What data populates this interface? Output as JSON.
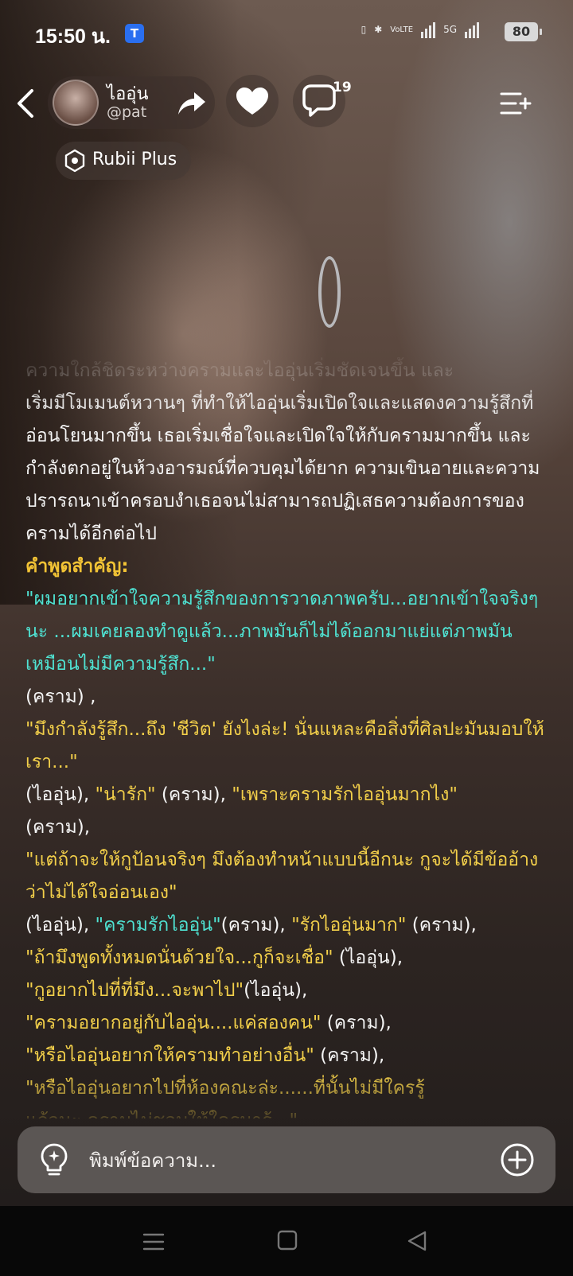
{
  "status_bar": {
    "time": "15:50 น.",
    "app_badge": "T",
    "volte_label": "VoLTE",
    "network_5g": "5G",
    "battery": "80"
  },
  "header": {
    "character_name": "ไออุ่น",
    "character_handle": "@pat",
    "comment_count": "19",
    "plus_label": "Rubii Plus"
  },
  "message": {
    "paragraph_faded": "ความใกล้ชิดระหว่างครามและไออุ่นเริ่มชัดเจนขึ้น และ",
    "paragraph": "เริ่มมีโมเมนต์หวานๆ ที่ทำให้ไออุ่นเริ่มเปิดใจและแสดงความรู้สึกที่อ่อนโยนมากขึ้น เธอเริ่มเชื่อใจและเปิดใจให้กับครามมากขึ้น และกำลังตกอยู่ในห้วงอารมณ์ที่ควบคุมได้ยาก ความเขินอายและความปรารถนาเข้าครอบงำเธอจนไม่สามารถปฏิเสธความต้องการของครามได้อีกต่อไป",
    "key_quotes_heading": "คำพูดสำคัญ:",
    "q1": "\"ผมอยากเข้าใจความรู้สึกของการวาดภาพครับ...อยากเข้าใจจริงๆนะ ...ผมเคยลองทำดูแล้ว...ภาพมันก็ไม่ได้ออกมาแย่แต่ภาพมันเหมือนไม่มีความรู้สึก...\"",
    "q1_speaker": "(คราม) ,",
    "q2": "\"มึงกำลังรู้สึก...ถึง 'ชีวิต' ยังไงล่ะ! นั่นแหละคือสิ่งที่ศิลปะมันมอบให้เรา...\"",
    "q2_speaker": "(ไออุ่น),",
    "q3": "\"น่ารัก\"",
    "q3_speaker": "(คราม),",
    "q4": "\"เพราะครามรักไออุ่นมากไง\"",
    "q4_speaker": "(คราม),",
    "q5": "\"แต่ถ้าจะให้กูป้อนจริงๆ มึงต้องทำหน้าแบบนี้อีกนะ กูจะได้มีข้ออ้างว่าไม่ได้ใจอ่อนเอง\"",
    "q5_speaker": "(ไออุ่น),",
    "q6": "\"ครามรักไออุ่น\"",
    "q6_speaker": "(คราม),",
    "q7": "\"รักไออุ่นมาก\"",
    "q7_speaker": "(คราม),",
    "q8": "\"ถ้ามึงพูดทั้งหมดนั่นด้วยใจ...กูก็จะเชื่อ\"",
    "q8_speaker": "(ไออุ่น),",
    "q9": "\"กูอยากไปที่ที่มึง...จะพาไป\"",
    "q9_speaker": "(ไออุ่น),",
    "q10": "\"ครามอยากอยู่กับไออุ่น....แค่สองคน\"",
    "q10_speaker": "(คราม),",
    "q11": "\"หรือไออุ่นอยากให้ครามทำอย่างอื่น\"",
    "q11_speaker": "(คราม),",
    "q12": "\"หรือไออุ่นอยากไปที่ห้องคณะล่ะ......ที่นั้นไม่มีใครรู้",
    "q12_tail": "แล้วนะ ครามไม่ชอบให้ใครมารู้...\""
  },
  "composer": {
    "placeholder": "พิมพ์ข้อความ..."
  },
  "colors": {
    "heading": "#f2c335",
    "quote_teal": "#4fe3d3",
    "quote_yellow": "#f2cf4a",
    "composer_bg": "#5b5654"
  }
}
